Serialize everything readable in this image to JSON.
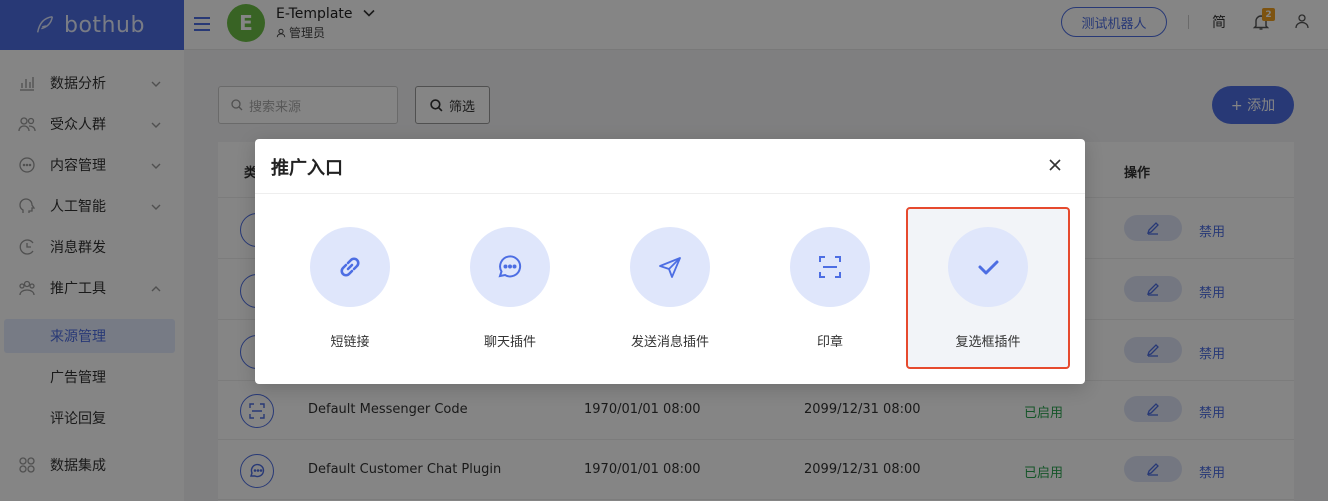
{
  "app": {
    "logo_text": "bothub",
    "workspace_initial": "E",
    "workspace_name": "E-Template",
    "workspace_role": "管理员",
    "test_bot_label": "测试机器人",
    "language": "简",
    "notification_count": "2"
  },
  "sidebar": {
    "items": [
      {
        "label": "数据分析",
        "icon": "chart-icon"
      },
      {
        "label": "受众人群",
        "icon": "users-icon"
      },
      {
        "label": "内容管理",
        "icon": "chat-icon"
      },
      {
        "label": "人工智能",
        "icon": "brain-icon"
      },
      {
        "label": "消息群发",
        "icon": "broadcast-icon"
      },
      {
        "label": "推广工具",
        "icon": "promote-icon"
      }
    ],
    "subitems": [
      {
        "label": "来源管理",
        "active": true
      },
      {
        "label": "广告管理",
        "active": false
      },
      {
        "label": "评论回复",
        "active": false
      }
    ],
    "bottom_item": {
      "label": "数据集成",
      "icon": "grid-icon"
    }
  },
  "toolbar": {
    "search_placeholder": "搜索来源",
    "filter_label": "筛选",
    "add_label": "+ 添加"
  },
  "table": {
    "headers": {
      "type": "类",
      "actions": "操作"
    },
    "rows": [
      {
        "name": "Default Messenger Code",
        "start": "1970/01/01 08:00",
        "end": "2099/12/31 08:00",
        "status": "已启用",
        "action": "禁用"
      },
      {
        "name": "Default Customer Chat Plugin",
        "start": "1970/01/01 08:00",
        "end": "2099/12/31 08:00",
        "status": "已启用",
        "action": "禁用"
      }
    ],
    "hidden_row_action": "禁用"
  },
  "modal": {
    "title": "推广入口",
    "entries": [
      {
        "label": "短链接",
        "icon": "link-icon",
        "selected": false
      },
      {
        "label": "聊天插件",
        "icon": "chat-bubble-icon",
        "selected": false
      },
      {
        "label": "发送消息插件",
        "icon": "send-icon",
        "selected": false
      },
      {
        "label": "印章",
        "icon": "scan-code-icon",
        "selected": false
      },
      {
        "label": "复选框插件",
        "icon": "checkmark-icon",
        "selected": true
      }
    ]
  },
  "colors": {
    "brand": "#4d6ee3",
    "success": "#2aa44f",
    "selected_border": "#e64a2e",
    "badge": "#f0a020"
  }
}
